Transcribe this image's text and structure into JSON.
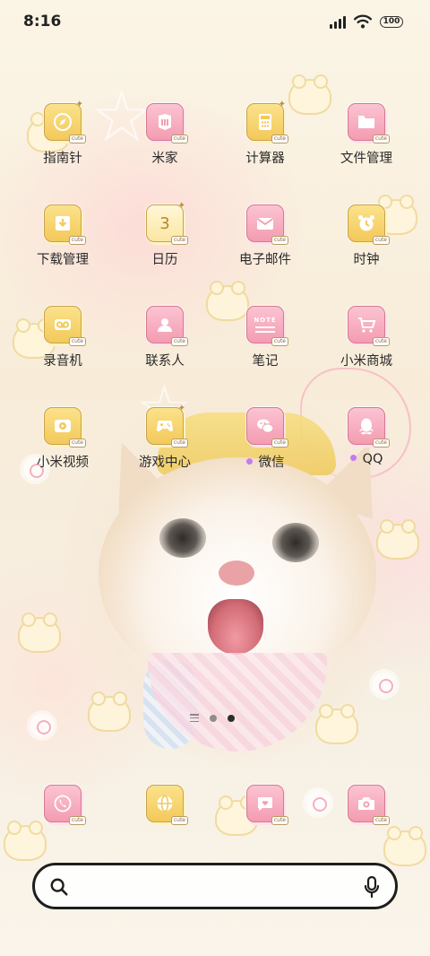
{
  "status_bar": {
    "time": "8:16",
    "battery": "100"
  },
  "apps": {
    "compass": "指南针",
    "mi_home": "米家",
    "calculator": "计算器",
    "file_manager": "文件管理",
    "downloads": "下载管理",
    "calendar": "日历",
    "calendar_icon_day": "3",
    "email": "电子邮件",
    "clock": "时钟",
    "recorder": "录音机",
    "contacts": "联系人",
    "notes": "笔记",
    "notes_icon_text": "NOTE",
    "mi_store": "小米商城",
    "mi_video": "小米视频",
    "game_center": "游戏中心",
    "wechat": "微信",
    "qq": "QQ"
  },
  "icon_badge": "cute",
  "search": {
    "placeholder": ""
  },
  "colors": {
    "yellow_tile": "#f3c95a",
    "pink_tile": "#f49cb1",
    "new_dot": "#c47bf0"
  }
}
